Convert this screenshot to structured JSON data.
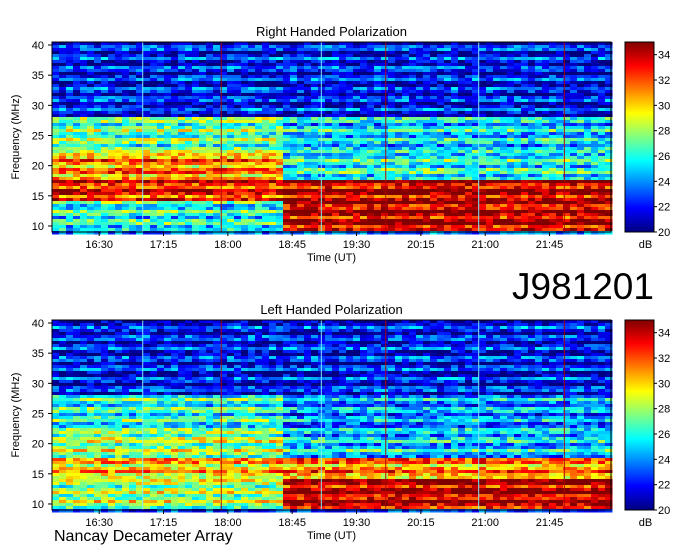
{
  "observation_id": "J981201",
  "instrument_label": "Nancay Decameter Array",
  "colorbar_scale": [
    "#00007f",
    "#0000ff",
    "#0080ff",
    "#00ffff",
    "#80ff80",
    "#ffff00",
    "#ff8000",
    "#ff0000",
    "#7f0000"
  ],
  "chart_data": [
    {
      "type": "heatmap",
      "title": "Right Handed Polarization",
      "xlabel": "Time (UT)",
      "ylabel": "Frequency (MHz)",
      "x_ticks": [
        "16:30",
        "17:15",
        "18:00",
        "18:45",
        "19:30",
        "20:15",
        "21:00",
        "21:45"
      ],
      "y_ticks": [
        10,
        15,
        20,
        25,
        30,
        35,
        40
      ],
      "ylim": [
        9,
        40.5
      ],
      "xlim": [
        "15:57",
        "22:28"
      ],
      "colorbar_label": "dB",
      "colorbar_ticks": [
        20,
        22,
        24,
        26,
        28,
        30,
        32,
        34
      ],
      "clim": [
        20,
        35
      ],
      "bands": [
        {
          "from": 9.3,
          "to": 14,
          "db_before_18_35": 26,
          "db_after_18_35": 34
        },
        {
          "from": 14,
          "to": 17.5,
          "db_before_18_35": 33,
          "db_after_18_35": 34
        },
        {
          "from": 17.5,
          "to": 22,
          "db_before_18_35": 31,
          "db_after_18_35": 26
        },
        {
          "from": 22,
          "to": 28,
          "db_before_18_35": 27,
          "db_after_18_35": 25
        },
        {
          "from": 28,
          "to": 40.5,
          "db_before_18_35": 22,
          "db_after_18_35": 22
        }
      ]
    },
    {
      "type": "heatmap",
      "title": "Left Handed Polarization",
      "xlabel": "Time (UT)",
      "ylabel": "Frequency (MHz)",
      "x_ticks": [
        "16:30",
        "17:15",
        "18:00",
        "18:45",
        "19:30",
        "20:15",
        "21:00",
        "21:45"
      ],
      "y_ticks": [
        10,
        15,
        20,
        25,
        30,
        35,
        40
      ],
      "ylim": [
        9,
        40.5
      ],
      "xlim": [
        "15:57",
        "22:28"
      ],
      "colorbar_label": "dB",
      "colorbar_ticks": [
        20,
        22,
        24,
        26,
        28,
        30,
        32,
        34
      ],
      "clim": [
        20,
        35
      ],
      "bands": [
        {
          "from": 9.3,
          "to": 14,
          "db_before_18_35": 28,
          "db_after_18_35": 34
        },
        {
          "from": 14,
          "to": 17.5,
          "db_before_18_35": 30,
          "db_after_18_35": 31
        },
        {
          "from": 17.5,
          "to": 22,
          "db_before_18_35": 28,
          "db_after_18_35": 25
        },
        {
          "from": 22,
          "to": 28,
          "db_before_18_35": 26,
          "db_after_18_35": 24
        },
        {
          "from": 28,
          "to": 40.5,
          "db_before_18_35": 22,
          "db_after_18_35": 22
        }
      ]
    }
  ]
}
